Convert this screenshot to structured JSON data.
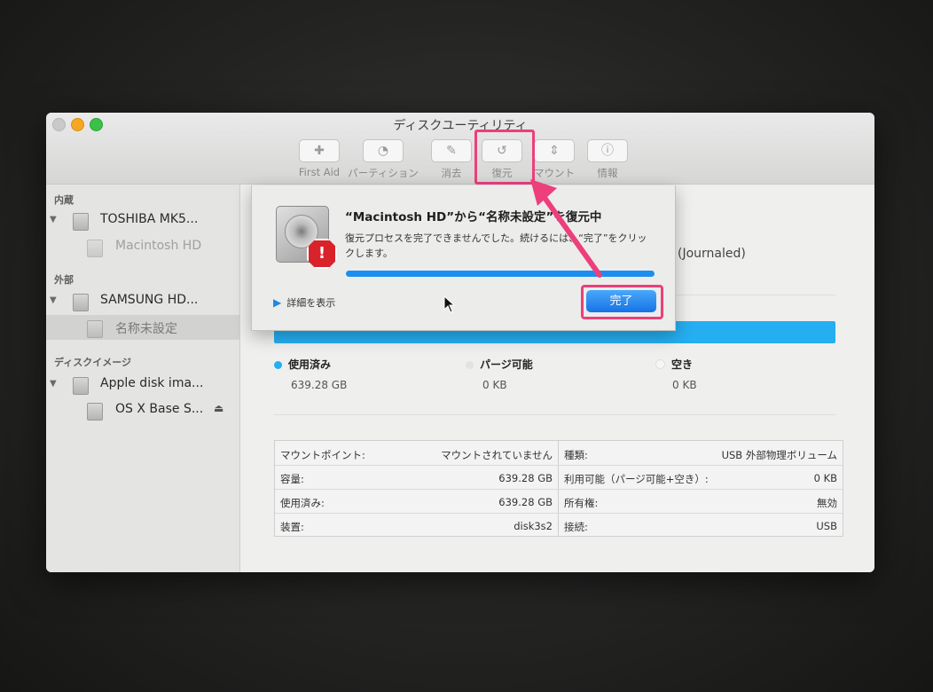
{
  "window": {
    "title": "ディスクユーティリティ"
  },
  "toolbar": [
    {
      "label": "First Aid",
      "icon": "stethoscope-icon",
      "glyph": "✚"
    },
    {
      "label": "パーティション",
      "icon": "partition-icon",
      "glyph": "◔"
    },
    {
      "label": "消去",
      "icon": "erase-icon",
      "glyph": "✎"
    },
    {
      "label": "復元",
      "icon": "restore-icon",
      "glyph": "↺"
    },
    {
      "label": "マウント",
      "icon": "mount-icon",
      "glyph": "⇕"
    },
    {
      "label": "情報",
      "icon": "info-icon",
      "glyph": "ⓘ"
    }
  ],
  "sidebar": {
    "internal": {
      "label": "内蔵",
      "disk": "TOSHIBA MK5...",
      "volume": "Macintosh HD"
    },
    "external": {
      "label": "外部",
      "disk": "SAMSUNG HD...",
      "volume": "名称未設定"
    },
    "images": {
      "label": "ディスクイメージ",
      "disk": "Apple disk ima...",
      "volume": "OS X Base S..."
    }
  },
  "main": {
    "format_fragment": "(Journaled)",
    "legend": [
      {
        "label": "使用済み",
        "value": "639.28 GB",
        "color": "#25aef0"
      },
      {
        "label": "パージ可能",
        "value": "0 KB",
        "color": "#e2e2e2"
      },
      {
        "label": "空き",
        "value": "0 KB",
        "color": "#f6f6f6"
      }
    ],
    "info_left": [
      {
        "key": "マウントポイント:",
        "value": "マウントされていません"
      },
      {
        "key": "容量:",
        "value": "639.28 GB"
      },
      {
        "key": "使用済み:",
        "value": "639.28 GB"
      },
      {
        "key": "装置:",
        "value": "disk3s2"
      }
    ],
    "info_right": [
      {
        "key": "種類:",
        "value": "USB 外部物理ボリューム"
      },
      {
        "key": "利用可能（パージ可能+空き）:",
        "value": "0 KB"
      },
      {
        "key": "所有権:",
        "value": "無効"
      },
      {
        "key": "接続:",
        "value": "USB"
      }
    ]
  },
  "sheet": {
    "title": "“Macintosh HD”から“名称未設定”を復元中",
    "message": "復元プロセスを完了できませんでした。続けるには、“完了”をクリックします。",
    "progress": 1.0,
    "details_label": "詳細を表示",
    "done_label": "完了"
  },
  "colors": {
    "accent": "#1b8ff0",
    "highlight": "#ec3f7c",
    "alert": "#d8232a"
  }
}
